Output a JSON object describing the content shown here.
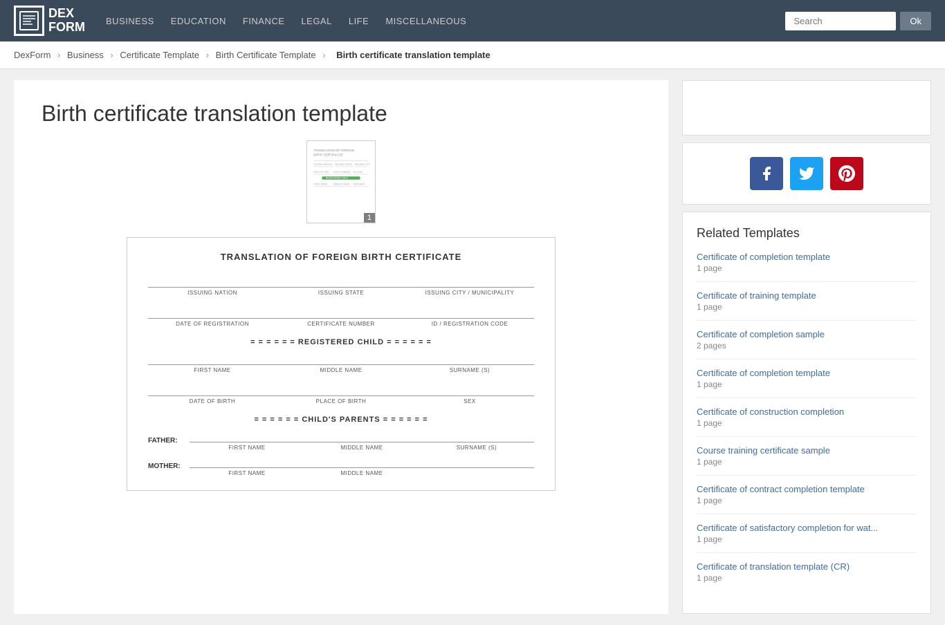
{
  "header": {
    "logo_line1": "DEX",
    "logo_line2": "FORM",
    "nav": [
      {
        "label": "BUSINESS",
        "href": "#"
      },
      {
        "label": "EDUCATION",
        "href": "#"
      },
      {
        "label": "FINANCE",
        "href": "#"
      },
      {
        "label": "LEGAL",
        "href": "#"
      },
      {
        "label": "LIFE",
        "href": "#"
      },
      {
        "label": "MISCELLANEOUS",
        "href": "#"
      }
    ],
    "search_placeholder": "Search",
    "search_btn_label": "Ok"
  },
  "breadcrumb": {
    "items": [
      {
        "label": "DexForm",
        "href": "#"
      },
      {
        "label": "Business",
        "href": "#"
      },
      {
        "label": "Certificate Template",
        "href": "#"
      },
      {
        "label": "Birth Certificate Template",
        "href": "#"
      }
    ],
    "current": "Birth certificate translation template"
  },
  "main": {
    "title": "Birth certificate translation template",
    "doc_page_number": "1",
    "cert": {
      "title": "TRANSLATION OF FOREIGN BIRTH CERTIFICATE",
      "row1": [
        {
          "label": "ISSUING NATION"
        },
        {
          "label": "ISSUING STATE"
        },
        {
          "label": "ISSUING CITY / MUNICIPALITY"
        }
      ],
      "row2": [
        {
          "label": "DATE OF REGISTRATION"
        },
        {
          "label": "CERTIFICATE NUMBER"
        },
        {
          "label": "ID / REGISTRATION CODE"
        }
      ],
      "registered_child_header": "= = = = = = REGISTERED CHILD = = = = = =",
      "row3": [
        {
          "label": "FIRST NAME"
        },
        {
          "label": "MIDDLE NAME"
        },
        {
          "label": "SURNAME (S)"
        }
      ],
      "row4": [
        {
          "label": "DATE OF BIRTH"
        },
        {
          "label": "PLACE OF BIRTH"
        },
        {
          "label": "SEX"
        }
      ],
      "parents_header": "= = = = = = CHILD'S PARENTS = = = = = =",
      "father_label": "FATHER:",
      "row5": [
        {
          "label": "FIRST NAME"
        },
        {
          "label": "MIDDLE NAME"
        },
        {
          "label": "SURNAME (S)"
        }
      ],
      "mother_label": "MOTHER:",
      "row6": [
        {
          "label": "FIRST NAME"
        },
        {
          "label": "MIDDLE NAME"
        },
        {
          "label": ""
        }
      ]
    }
  },
  "sidebar": {
    "social": {
      "facebook_label": "Facebook",
      "twitter_label": "Twitter",
      "pinterest_label": "Pinterest"
    },
    "related_title": "Related Templates",
    "related_items": [
      {
        "label": "Certificate of completion template",
        "pages": "1 page",
        "href": "#"
      },
      {
        "label": "Certificate of training template",
        "pages": "1 page",
        "href": "#"
      },
      {
        "label": "Certificate of completion sample",
        "pages": "2 pages",
        "href": "#"
      },
      {
        "label": "Certificate of completion template",
        "pages": "1 page",
        "href": "#"
      },
      {
        "label": "Certificate of construction completion",
        "pages": "1 page",
        "href": "#"
      },
      {
        "label": "Course training certificate sample",
        "pages": "1 page",
        "href": "#"
      },
      {
        "label": "Certificate of contract completion template",
        "pages": "1 page",
        "href": "#"
      },
      {
        "label": "Certificate of satisfactory completion for wat...",
        "pages": "1 page",
        "href": "#"
      },
      {
        "label": "Certificate of translation template (CR)",
        "pages": "1 page",
        "href": "#"
      }
    ]
  }
}
